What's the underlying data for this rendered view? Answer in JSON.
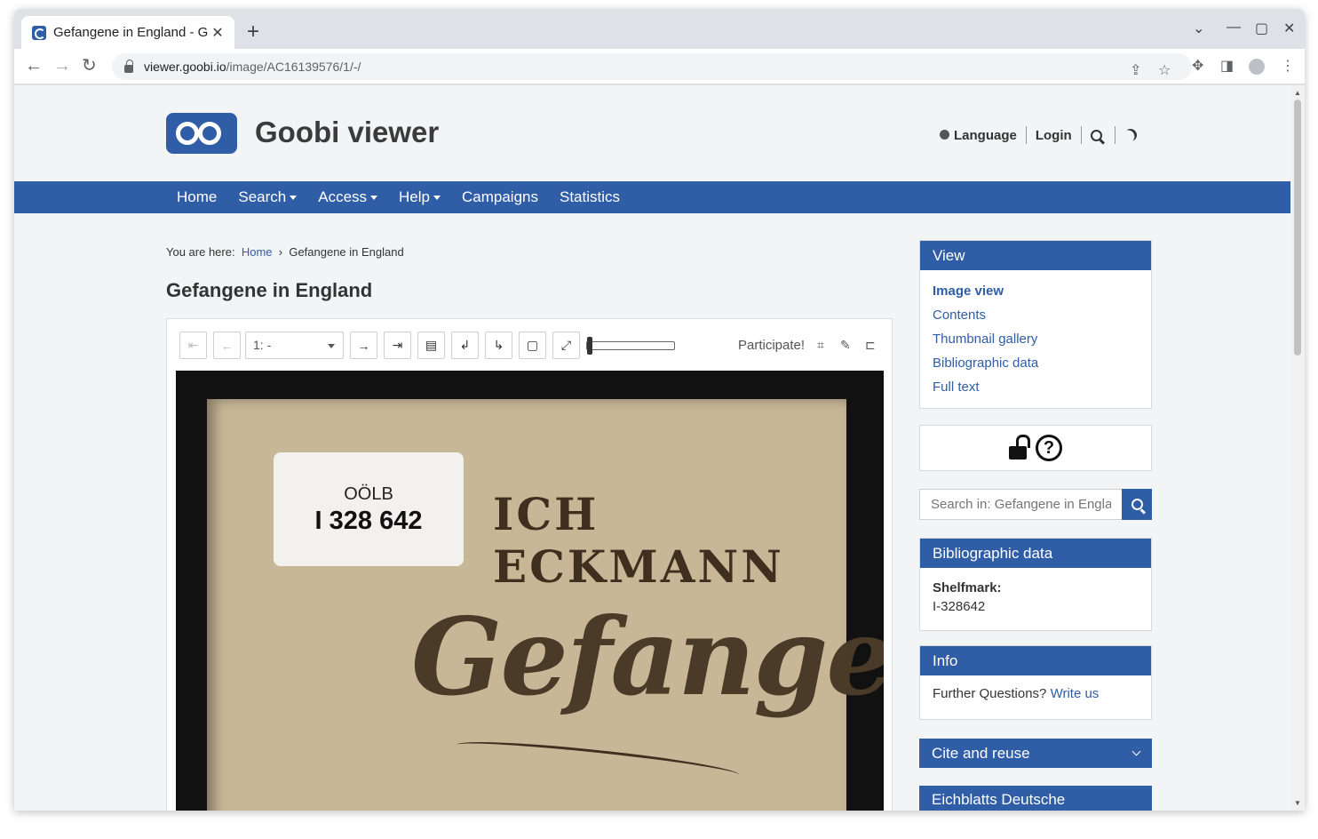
{
  "browser": {
    "tab_title": "Gefangene in England - G",
    "tab_close": "✕",
    "new_tab": "+",
    "url_host": "viewer.goobi.io",
    "url_path": "/image/AC16139576/1/-/",
    "window_controls": [
      "⌄",
      "—",
      "▢",
      "✕"
    ]
  },
  "site": {
    "logo_text": "Goobi viewer",
    "header_links": {
      "language": "Language",
      "login": "Login"
    }
  },
  "nav": {
    "items": [
      {
        "label": "Home",
        "dropdown": false
      },
      {
        "label": "Search",
        "dropdown": true
      },
      {
        "label": "Access",
        "dropdown": true
      },
      {
        "label": "Help",
        "dropdown": true
      },
      {
        "label": "Campaigns",
        "dropdown": false
      },
      {
        "label": "Statistics",
        "dropdown": false
      }
    ]
  },
  "breadcrumb": {
    "prefix": "You are here:",
    "home": "Home",
    "separator": "›",
    "current": "Gefangene in England"
  },
  "page_title": "Gefangene in England",
  "viewer": {
    "page_select_value": "1: -",
    "participate_label": "Participate!",
    "icons": {
      "first": "⇤",
      "prev": "←",
      "next": "→",
      "last": "⇥",
      "double_page": "▤",
      "rotate_left": "↲",
      "rotate_right": "↳",
      "reset": "▢",
      "fullscreen": "⤢",
      "crop": "⌗",
      "wrench": "✎",
      "bookmark": "⊏"
    },
    "zoom_level": 0.0,
    "cover": {
      "sticker_line1": "OÖLB",
      "sticker_line2": "I 328 642",
      "author": "ICH ECKMANN",
      "title": "Gefangene"
    }
  },
  "sidebar": {
    "view": {
      "heading": "View",
      "links": [
        "Image view",
        "Contents",
        "Thumbnail gallery",
        "Bibliographic data",
        "Full text"
      ],
      "active_index": 0
    },
    "search": {
      "placeholder": "Search in: Gefangene in England"
    },
    "bibliographic": {
      "heading": "Bibliographic data",
      "shelfmark_label": "Shelfmark:",
      "shelfmark_value": "I-328642"
    },
    "info": {
      "heading": "Info",
      "text": "Further Questions?",
      "link": "Write us"
    },
    "cite": {
      "heading": "Cite and reuse"
    },
    "collection": {
      "heading": "Eichblatts Deutsche Heimatbücher"
    }
  },
  "colors": {
    "brand": "#2f5da6",
    "page_bg": "#f3f4f5"
  }
}
